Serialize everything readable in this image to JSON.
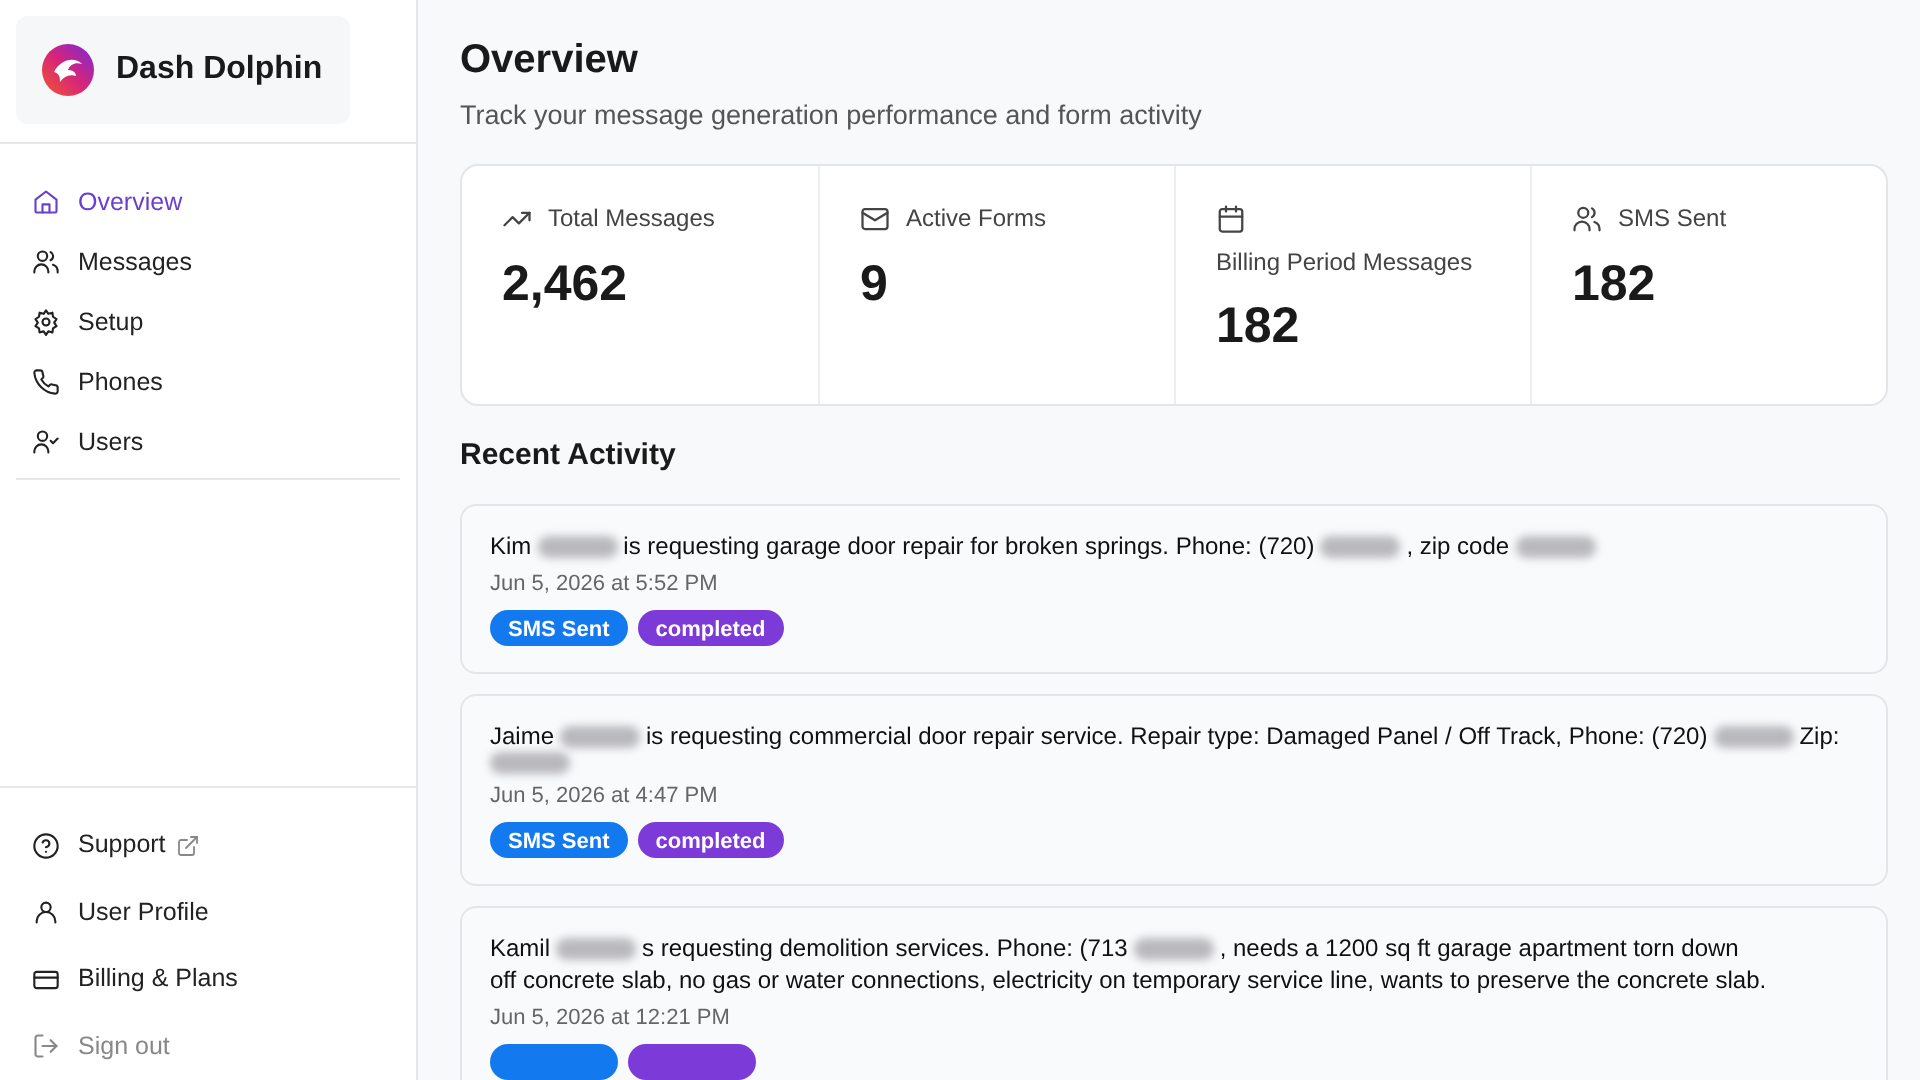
{
  "sidebar": {
    "brand": "Dash Dolphin",
    "nav": [
      {
        "label": "Overview",
        "selected": true
      },
      {
        "label": "Messages",
        "selected": false
      },
      {
        "label": "Setup",
        "selected": false
      },
      {
        "label": "Phones",
        "selected": false
      },
      {
        "label": "Users",
        "selected": false
      }
    ],
    "footer": [
      {
        "label": "Support",
        "external": true,
        "muted": false
      },
      {
        "label": "User Profile",
        "external": false,
        "muted": false
      },
      {
        "label": "Billing & Plans",
        "external": false,
        "muted": false
      },
      {
        "label": "Sign out",
        "external": false,
        "muted": true
      }
    ]
  },
  "header": {
    "title": "Overview",
    "subtitle": "Track your message generation performance and form activity"
  },
  "stats": [
    {
      "label": "Total Messages",
      "value": "2,462"
    },
    {
      "label": "Active Forms",
      "value": "9"
    },
    {
      "label": "Billing Period Messages",
      "value": "182"
    },
    {
      "label": "SMS Sent",
      "value": "182"
    }
  ],
  "recent_activity": {
    "title": "Recent Activity",
    "items": [
      {
        "message": [
          {
            "kind": "text",
            "text": "Kim"
          },
          {
            "kind": "blur"
          },
          {
            "kind": "text",
            "text": "is requesting garage door repair for broken springs. Phone: (720)"
          },
          {
            "kind": "blur"
          },
          {
            "kind": "text",
            "text": ", zip code"
          },
          {
            "kind": "blur"
          }
        ],
        "time": "Jun 5, 2026 at 5:52 PM",
        "tags": [
          {
            "kind": "sms",
            "label": "SMS Sent"
          },
          {
            "kind": "status",
            "label": "completed"
          }
        ]
      },
      {
        "message": [
          {
            "kind": "text",
            "text": "Jaime"
          },
          {
            "kind": "blur"
          },
          {
            "kind": "text",
            "text": "is requesting commercial door repair service. Repair type: Damaged Panel / Off Track, Phone: (720)"
          },
          {
            "kind": "blur"
          },
          {
            "kind": "text",
            "text": "Zip:"
          },
          {
            "kind": "blur"
          }
        ],
        "time": "Jun 5, 2026 at 4:47 PM",
        "tags": [
          {
            "kind": "sms",
            "label": "SMS Sent"
          },
          {
            "kind": "status",
            "label": "completed"
          }
        ]
      },
      {
        "message": [
          {
            "kind": "text",
            "text": "Kamil"
          },
          {
            "kind": "blur"
          },
          {
            "kind": "text",
            "text": "s requesting demolition services. Phone: (713"
          },
          {
            "kind": "blur"
          },
          {
            "kind": "text",
            "text": ", needs a 1200 sq ft garage apartment torn down"
          },
          {
            "kind": "text",
            "text": "off concrete slab, no gas or water connections, electricity on temporary service line, wants to preserve the concrete slab."
          }
        ],
        "time": "Jun 5, 2026 at 12:21 PM",
        "tags": [
          {
            "kind": "sms"
          },
          {
            "kind": "status"
          }
        ]
      }
    ]
  }
}
